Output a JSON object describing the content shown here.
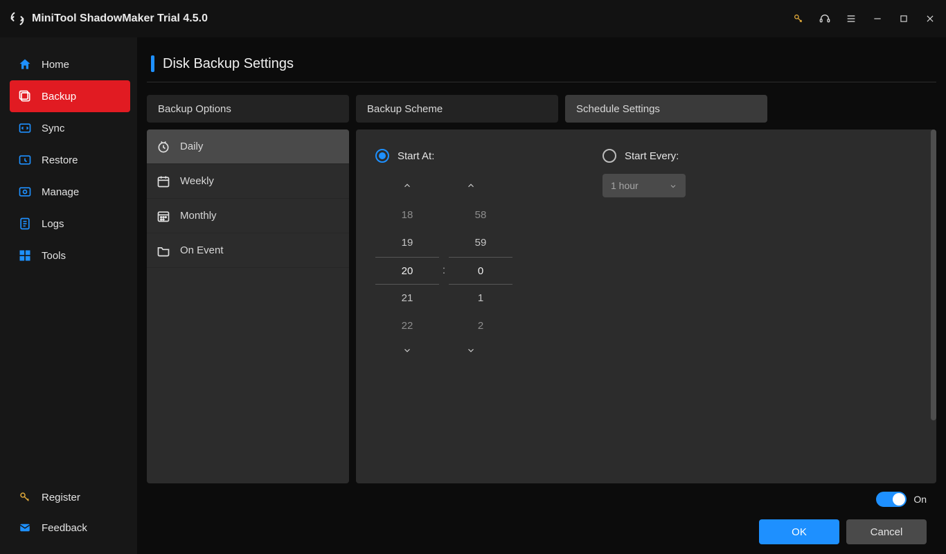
{
  "app": {
    "title": "MiniTool ShadowMaker Trial 4.5.0"
  },
  "sidebar": {
    "items": [
      {
        "label": "Home"
      },
      {
        "label": "Backup"
      },
      {
        "label": "Sync"
      },
      {
        "label": "Restore"
      },
      {
        "label": "Manage"
      },
      {
        "label": "Logs"
      },
      {
        "label": "Tools"
      }
    ],
    "bottom": [
      {
        "label": "Register"
      },
      {
        "label": "Feedback"
      }
    ]
  },
  "page": {
    "title": "Disk Backup Settings"
  },
  "tabs": [
    {
      "label": "Backup Options"
    },
    {
      "label": "Backup Scheme"
    },
    {
      "label": "Schedule Settings"
    }
  ],
  "subtabs": [
    {
      "label": "Daily"
    },
    {
      "label": "Weekly"
    },
    {
      "label": "Monthly"
    },
    {
      "label": "On Event"
    }
  ],
  "schedule": {
    "start_at_label": "Start At:",
    "start_every_label": "Start Every:",
    "start_every_value": "1 hour",
    "hours": {
      "m2": "18",
      "m1": "19",
      "sel": "20",
      "p1": "21",
      "p2": "22"
    },
    "minutes": {
      "m2": "58",
      "m1": "59",
      "sel": "0",
      "p1": "1",
      "p2": "2"
    },
    "colon": ":"
  },
  "footer": {
    "toggle_label": "On",
    "ok_label": "OK",
    "cancel_label": "Cancel"
  }
}
